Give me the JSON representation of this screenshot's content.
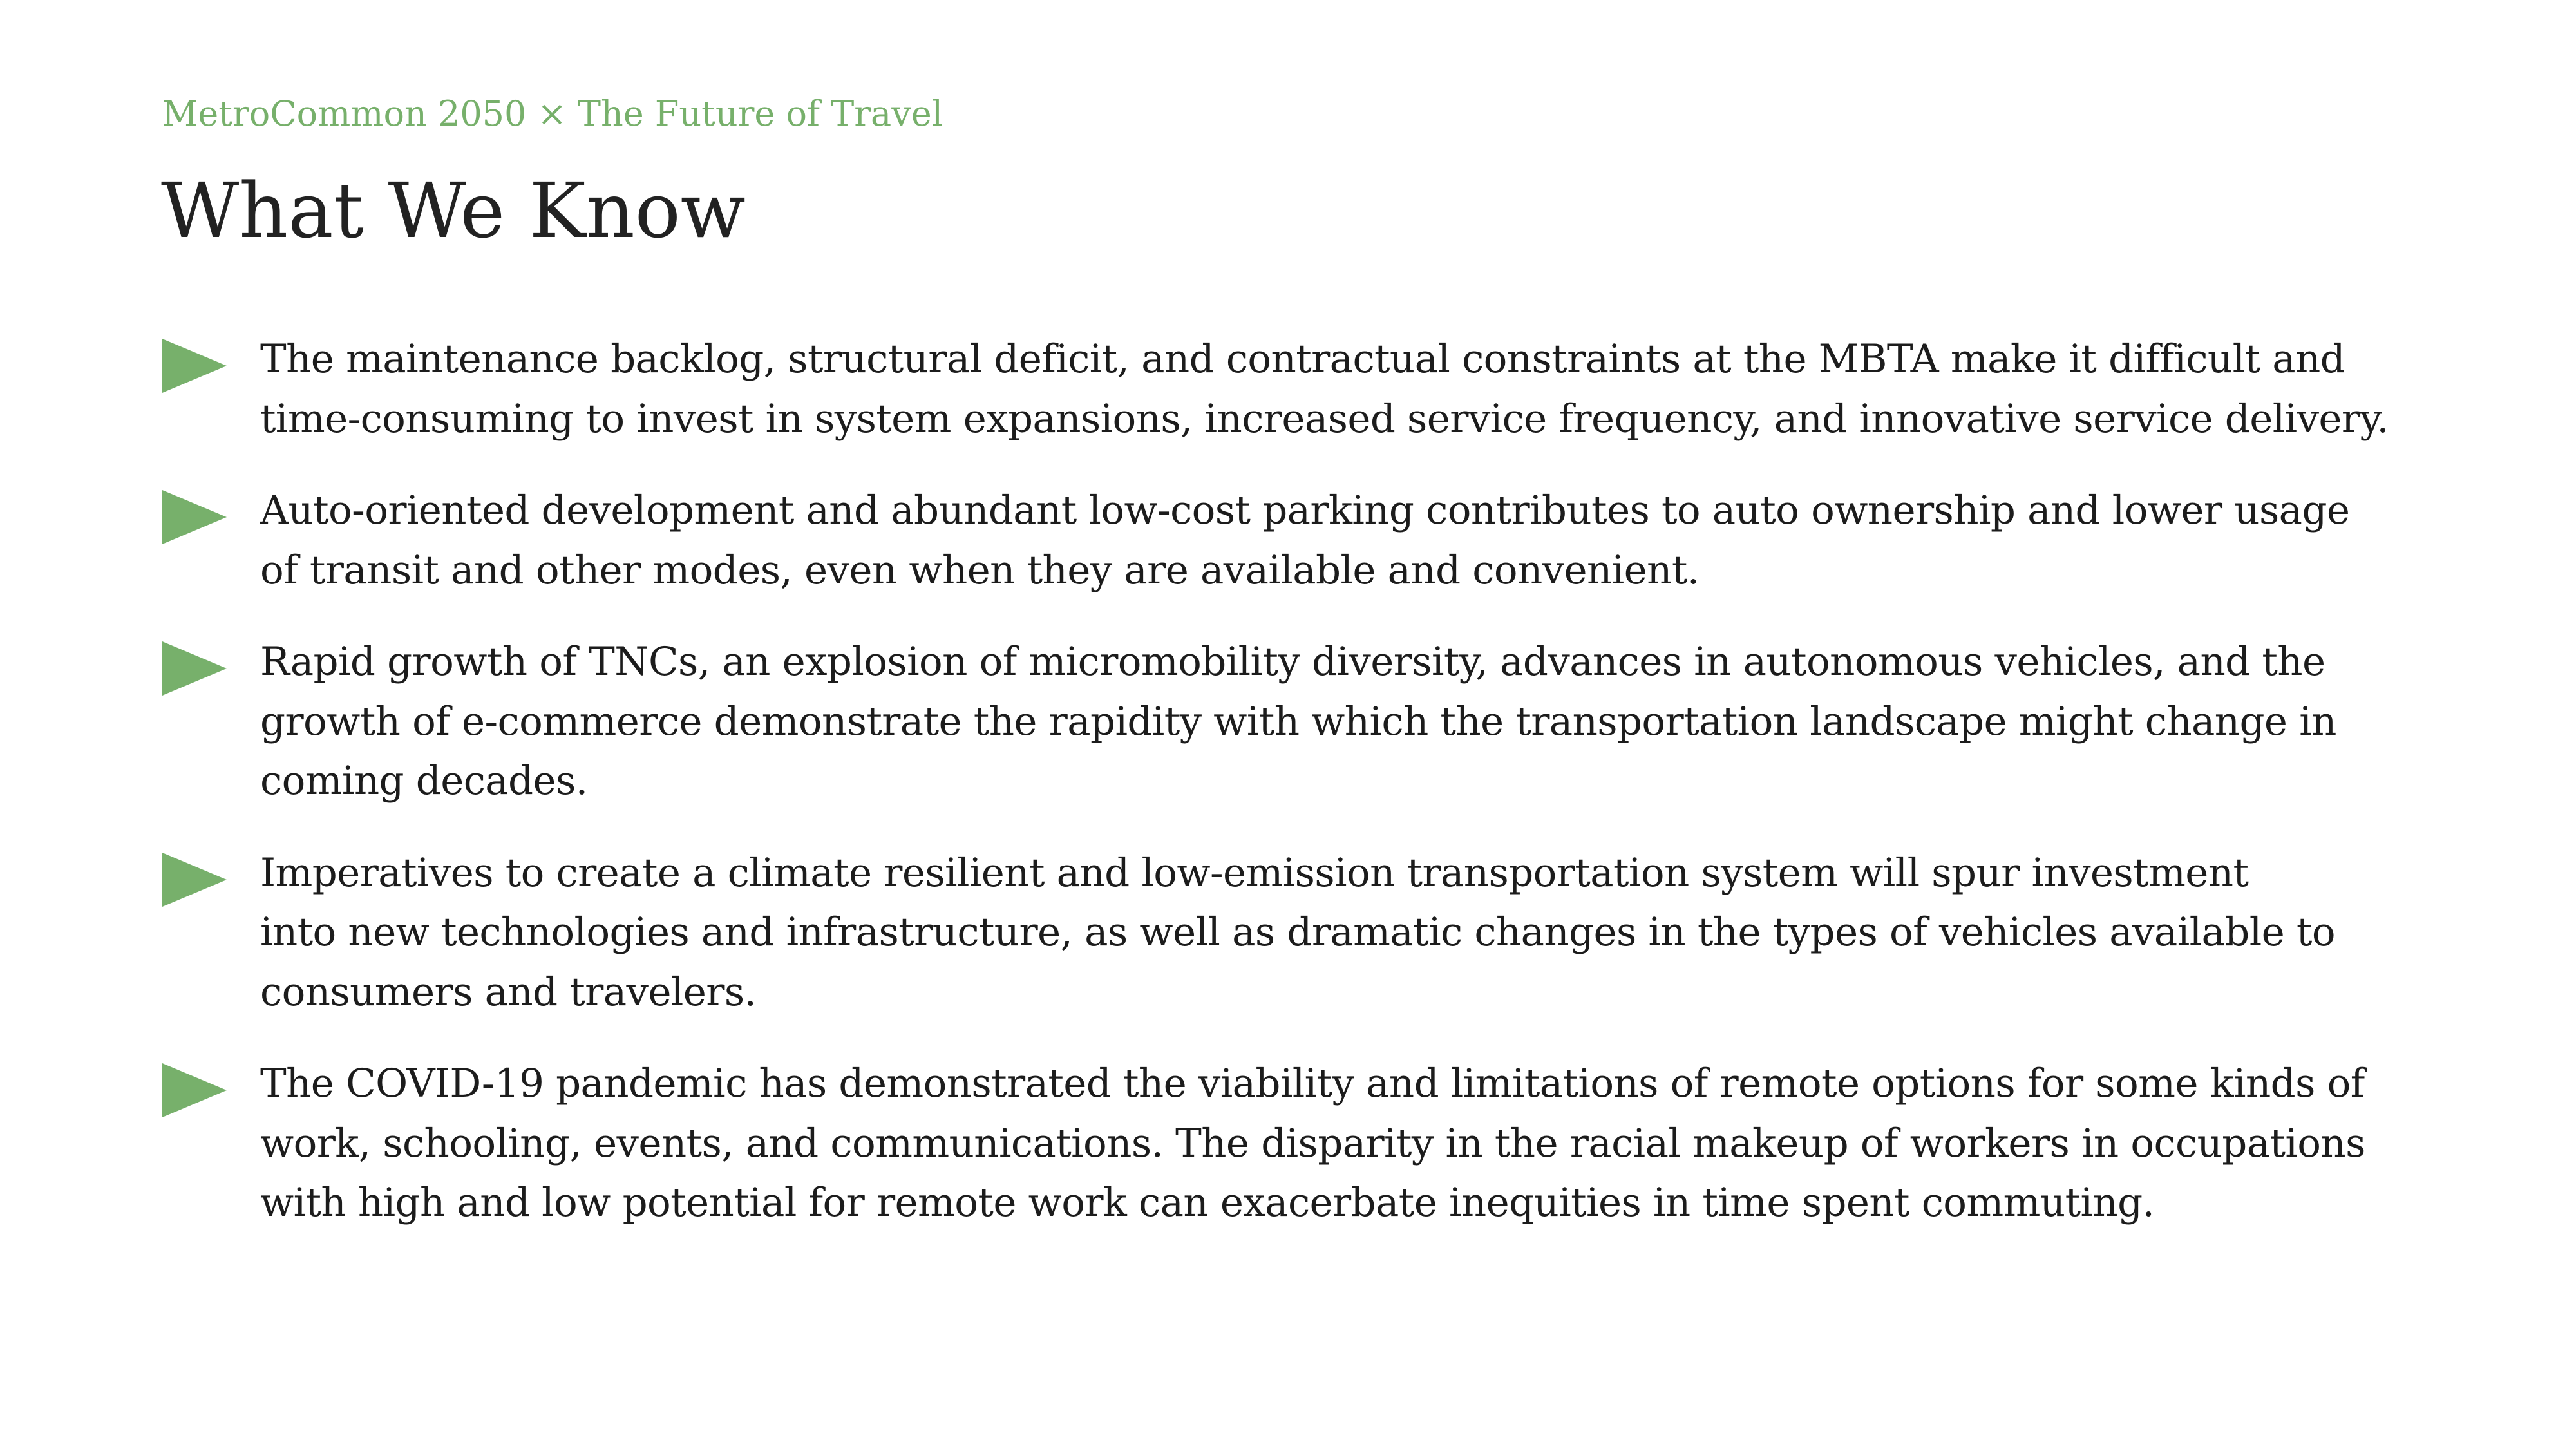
{
  "slide": {
    "kicker": "MetroCommon 2050 × The Future of Travel",
    "title": "What We Know",
    "accent_color": "#77b06b",
    "bullet_icon": "triangle-bullet-icon",
    "bullets": [
      {
        "lines": [
          "The maintenance backlog, structural deficit, and contractual constraints at the MBTA make it difficult and",
          "time-consuming to invest in system expansions, increased service frequency, and innovative service delivery."
        ]
      },
      {
        "lines": [
          "Auto-oriented development and abundant low-cost parking contributes to auto ownership and lower usage",
          "of transit and other modes, even when they are available and convenient."
        ]
      },
      {
        "lines": [
          "Rapid growth of TNCs, an explosion of micromobility diversity, advances in autonomous vehicles, and the",
          "growth of e-commerce demonstrate the rapidity with which the transportation landscape might change in",
          "coming decades."
        ]
      },
      {
        "lines": [
          "Imperatives to create a climate resilient and low-emission transportation system will spur investment",
          "into new technologies and infrastructure, as well as dramatic changes in the types of vehicles available to",
          "consumers and travelers."
        ]
      },
      {
        "lines": [
          "The COVID-19 pandemic has demonstrated the viability and limitations of remote options for some kinds of",
          "work, schooling, events, and communications. The disparity in the racial makeup of workers in occupations",
          "with high and low potential for remote work can exacerbate inequities in time spent commuting."
        ]
      }
    ]
  }
}
